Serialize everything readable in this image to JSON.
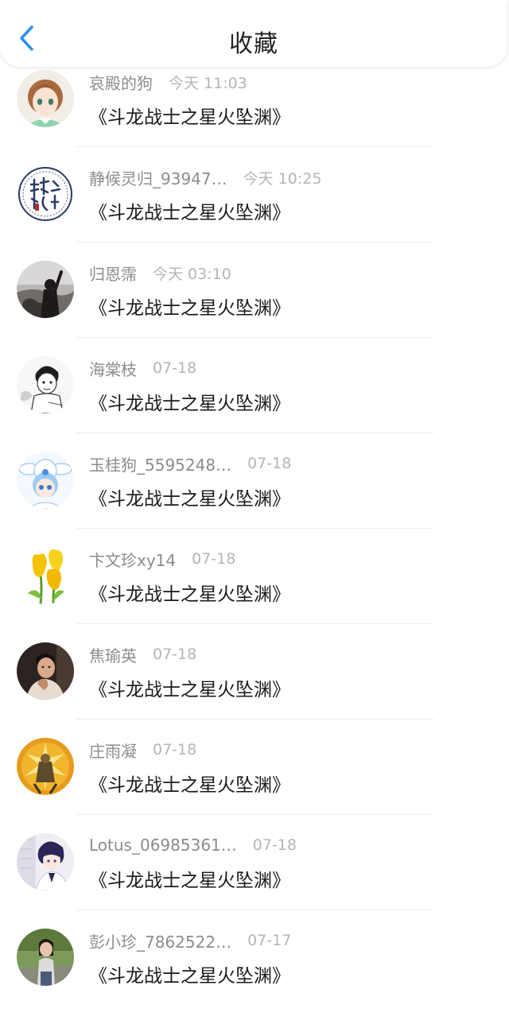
{
  "header": {
    "title": "收藏",
    "back_icon": "chevron-left-icon",
    "accent_color": "#2d8ff0"
  },
  "items": [
    {
      "user": "哀殿的狗",
      "time": "今天 11:03",
      "book": "《斗龙战士之星火坠渊》",
      "avatar": "anime-girl"
    },
    {
      "user": "静候灵归_93947…",
      "time": "今天 10:25",
      "book": "《斗龙战士之星火坠渊》",
      "avatar": "calligraphy-seal"
    },
    {
      "user": "归恩霈",
      "time": "今天 03:10",
      "book": "《斗龙战士之星火坠渊》",
      "avatar": "girl-silhouette"
    },
    {
      "user": "海棠枝",
      "time": "07-18",
      "book": "《斗龙战士之星火坠渊》",
      "avatar": "manga-boy"
    },
    {
      "user": "玉桂狗_5595248…",
      "time": "07-18",
      "book": "《斗龙战士之星火坠渊》",
      "avatar": "cinnamoroll-girl"
    },
    {
      "user": "卞文珍xy14",
      "time": "07-18",
      "book": "《斗龙战士之星火坠渊》",
      "avatar": "yellow-tulips"
    },
    {
      "user": "焦瑜英",
      "time": "07-18",
      "book": "《斗龙战士之星火坠渊》",
      "avatar": "young-man"
    },
    {
      "user": "庄雨凝",
      "time": "07-18",
      "book": "《斗龙战士之星火坠渊》",
      "avatar": "golden-creature"
    },
    {
      "user": "Lotus_06985361…",
      "time": "07-18",
      "book": "《斗龙战士之星火坠渊》",
      "avatar": "anime-boy"
    },
    {
      "user": "彭小珍_7862522…",
      "time": "07-17",
      "book": "《斗龙战士之星火坠渊》",
      "avatar": "girl-outdoor"
    }
  ]
}
